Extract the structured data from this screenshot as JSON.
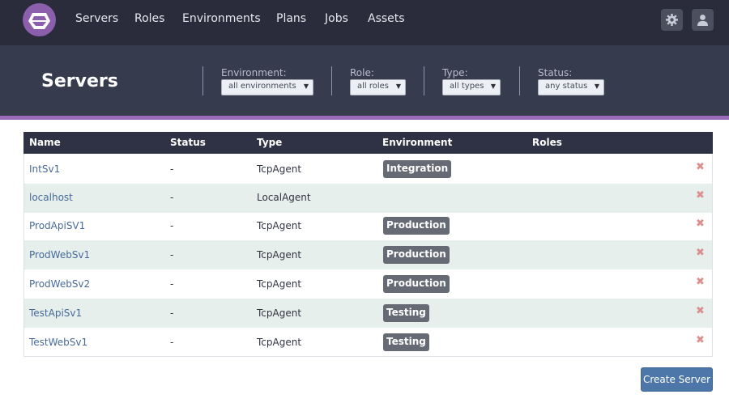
{
  "nav": {
    "links": [
      "Servers",
      "Roles",
      "Environments",
      "Plans",
      "Jobs",
      "Assets"
    ],
    "settings_icon": "gear-icon",
    "user_icon": "user-icon",
    "logo_icon": "octopus-logo-icon"
  },
  "header": {
    "title": "Servers",
    "filters": [
      {
        "label": "Environment:",
        "value": "all environments"
      },
      {
        "label": "Role:",
        "value": "all roles"
      },
      {
        "label": "Type:",
        "value": "all types"
      },
      {
        "label": "Status:",
        "value": "any status"
      }
    ],
    "caret": "▼"
  },
  "table": {
    "columns": [
      "Name",
      "Status",
      "Type",
      "Environment",
      "Roles"
    ],
    "delete_glyph": "✖",
    "rows": [
      {
        "name": "IntSv1",
        "status": "-",
        "type": "TcpAgent",
        "environment": "Integration",
        "roles": ""
      },
      {
        "name": "localhost",
        "status": "-",
        "type": "LocalAgent",
        "environment": "",
        "roles": ""
      },
      {
        "name": "ProdApiSV1",
        "status": "-",
        "type": "TcpAgent",
        "environment": "Production",
        "roles": ""
      },
      {
        "name": "ProdWebSv1",
        "status": "-",
        "type": "TcpAgent",
        "environment": "Production",
        "roles": ""
      },
      {
        "name": "ProdWebSv2",
        "status": "-",
        "type": "TcpAgent",
        "environment": "Production",
        "roles": ""
      },
      {
        "name": "TestApiSv1",
        "status": "-",
        "type": "TcpAgent",
        "environment": "Testing",
        "roles": ""
      },
      {
        "name": "TestWebSv1",
        "status": "-",
        "type": "TcpAgent",
        "environment": "Testing",
        "roles": ""
      }
    ]
  },
  "actions": {
    "create_label": "Create Server"
  },
  "colors": {
    "nav_bg": "#2a2c3c",
    "header_bg": "#363b4d",
    "accent": "#9b6ab8",
    "link": "#476a9a",
    "badge": "#666a75",
    "delete": "#dc8f8c",
    "button": "#4d77a8"
  }
}
